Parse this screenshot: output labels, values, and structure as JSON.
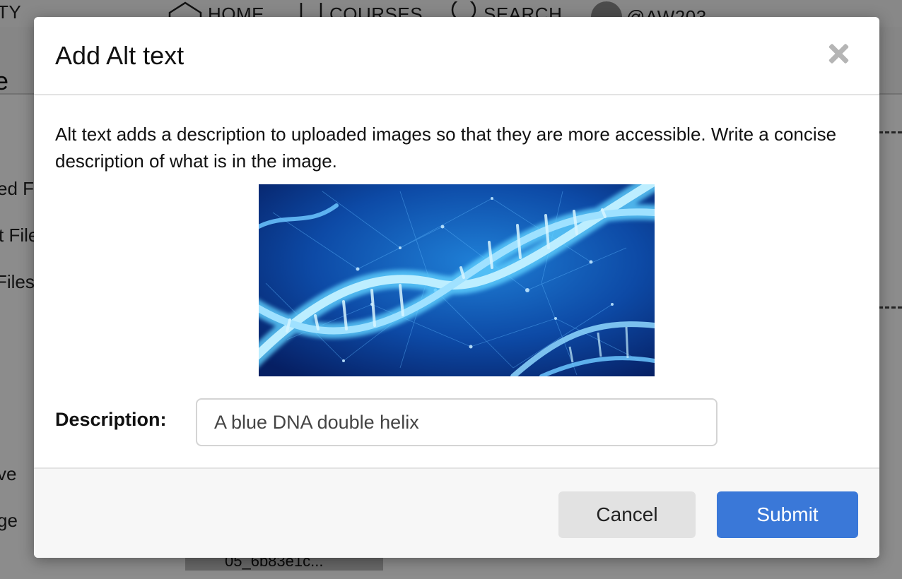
{
  "background": {
    "nav": {
      "partial_left": "TY",
      "home": "HOME",
      "courses": "COURSES",
      "search": "SEARCH",
      "username": "@AW203"
    },
    "header_partial": "e",
    "sidebar_partials": [
      "ed F",
      "t File",
      "Files",
      "ve",
      "ge"
    ],
    "file_chip": "05_6b83e1c..."
  },
  "modal": {
    "title": "Add Alt text",
    "intro": "Alt text adds a description to uploaded images so that they are more accessible. Write a concise description of what is in the image.",
    "description_label": "Description:",
    "description_value": "A blue DNA double helix",
    "cancel_label": "Cancel",
    "submit_label": "Submit"
  },
  "colors": {
    "primary": "#3a78d8",
    "secondary_button": "#e2e2e2",
    "overlay": "rgba(0,0,0,0.45)"
  },
  "icons": [
    "home-icon",
    "courses-icon",
    "search-icon",
    "avatar",
    "close-icon"
  ]
}
